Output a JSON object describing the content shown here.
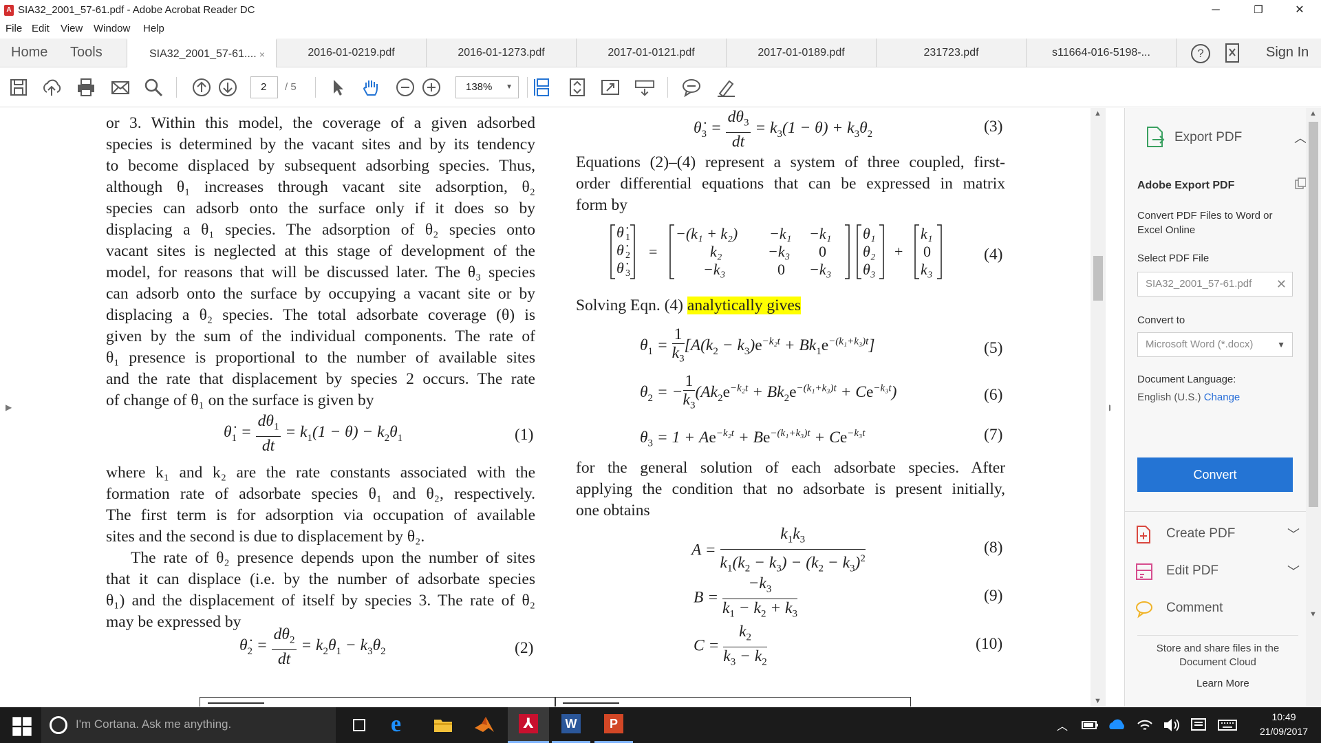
{
  "window": {
    "title": "SIA32_2001_57-61.pdf - Adobe Acrobat Reader DC",
    "minimize": "─",
    "restore": "❐",
    "close": "✕"
  },
  "menu": [
    "File",
    "Edit",
    "View",
    "Window",
    "Help"
  ],
  "nav": {
    "home": "Home",
    "tools": "Tools"
  },
  "tabs": [
    {
      "label": "SIA32_2001_57-61....",
      "active": true,
      "close": "×"
    },
    {
      "label": "2016-01-0219.pdf"
    },
    {
      "label": "2016-01-1273.pdf"
    },
    {
      "label": "2017-01-0121.pdf"
    },
    {
      "label": "2017-01-0189.pdf"
    },
    {
      "label": "231723.pdf"
    },
    {
      "label": "s11664-016-5198-..."
    }
  ],
  "signin": "Sign In",
  "help_glyph": "?",
  "toolbar": {
    "page_current": "2",
    "page_total": "/ 5",
    "zoom": "138%"
  },
  "document": {
    "left_col": [
      "or 3. Within this model, the coverage of a given adsorbed",
      "species is determined by the vacant sites and by its tendency",
      "to become displaced by subsequent adsorbing species. Thus,",
      "although θ₁ increases through vacant site adsorption, θ₂",
      "species can adsorb onto the surface only if it does so by",
      "displacing a θ₁ species. The adsorption of θ₂ species onto",
      "vacant sites is neglected at this stage of development of the",
      "model, for reasons that will be discussed later. The θ₃ species",
      "can adsorb onto the surface by occupying a vacant site or by",
      "displacing a θ₂ species. The total adsorbate coverage (θ) is",
      "given by the sum of the individual components. The rate of",
      "θ₁ presence is proportional to the number of available sites",
      "and the rate that displacement by species 2 occurs. The rate",
      "of change of θ₁ on the surface is given by"
    ],
    "left_col2": [
      "where k₁ and k₂ are the rate constants associated with the",
      "formation rate of adsorbate species θ₁ and θ₂, respectively.",
      "The first term is for adsorption via occupation of available",
      "sites and the second is due to displacement by θ₂."
    ],
    "left_col3": [
      "The rate of θ₂ presence depends upon the number of sites",
      "that it can displace (i.e. by the number of adsorbate species",
      "θ₁) and the displacement of itself by species 3. The rate of θ₂",
      "may be expressed by"
    ],
    "right_col1": [
      "Equations (2)–(4) represent a system of three coupled, first-",
      "order differential equations that can be expressed in matrix",
      "form by"
    ],
    "solving_prefix": "Solving Eqn. (4) ",
    "solving_highlight": "analytically gives",
    "right_col2": [
      "for the general solution of each adsorbate species. After",
      "applying the condition that no adsorbate is present initially,",
      "one obtains"
    ],
    "eq_numbers": [
      "(1)",
      "(2)",
      "(3)",
      "(4)",
      "(5)",
      "(6)",
      "(7)",
      "(8)",
      "(9)",
      "(10)"
    ]
  },
  "panel": {
    "export_title": "Export PDF",
    "adobe_export": "Adobe Export PDF",
    "desc": "Convert PDF Files to Word or Excel Online",
    "select_file": "Select PDF File",
    "file_name": "SIA32_2001_57-61.pdf",
    "convert_to": "Convert to",
    "format": "Microsoft Word (*.docx)",
    "doc_lang": "Document Language:",
    "lang": "English (U.S.)",
    "change": "Change",
    "convert": "Convert",
    "create_pdf": "Create PDF",
    "edit_pdf": "Edit PDF",
    "comment": "Comment",
    "store": "Store and share files in the Document Cloud",
    "learn_more": "Learn More"
  },
  "taskbar": {
    "cortana": "I'm Cortana. Ask me anything.",
    "time": "10:49",
    "date": "21/09/2017"
  },
  "colors": {
    "accent": "#2474d4",
    "highlight": "#ffff00",
    "taskbar": "#1b1b1b"
  }
}
